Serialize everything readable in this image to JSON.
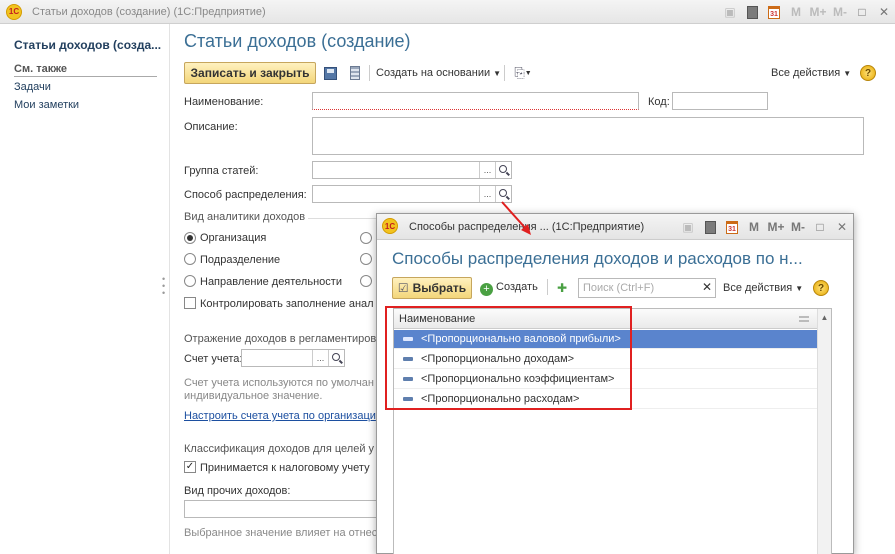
{
  "window": {
    "title": "Статьи доходов (создание)   (1С:Предприятие)",
    "logo_text": "1С",
    "buttons": [
      "M",
      "M+",
      "M-"
    ]
  },
  "sidebar": {
    "title": "Статьи доходов (созда...",
    "section": "См. также",
    "items": [
      "Задачи",
      "Мои заметки"
    ]
  },
  "form": {
    "title": "Статьи доходов (создание)",
    "toolbar": {
      "save_close": "Записать и закрыть",
      "create_based": "Создать на основании",
      "all_actions": "Все действия",
      "help": "?"
    },
    "fields": {
      "name_label": "Наименование:",
      "code_label": "Код:",
      "description_label": "Описание:",
      "group_label": "Группа статей:",
      "distribution_label": "Способ распределения:",
      "select_btn": "..."
    },
    "analytics": {
      "header": "Вид аналитики доходов",
      "options": [
        "Организация",
        "Подразделение",
        "Направление деятельности"
      ],
      "control_fill": "Контролировать заполнение анал"
    },
    "reflection": {
      "header": "Отражение доходов в регламентиров",
      "account_label": "Счет учета:",
      "note1": "Счет учета используются по умолчан",
      "note2": "индивидуальное значение.",
      "link": "Настроить счета учета по организаци"
    },
    "classification": {
      "header": "Классификация доходов для целей у",
      "tax_checkbox": "Принимается к налоговому учету",
      "other_income_label": "Вид прочих доходов:",
      "note": "Выбранное значение влияет на отнес"
    }
  },
  "dialog": {
    "title": "Способы распределения ...  (1С:Предприятие)",
    "logo_text": "1С",
    "heading": "Способы распределения доходов и расходов по н...",
    "toolbar": {
      "select": "Выбрать",
      "create": "Создать",
      "search_placeholder": "Поиск (Ctrl+F)",
      "all_actions": "Все действия",
      "help": "?"
    },
    "table": {
      "column": "Наименование",
      "rows": [
        "<Пропорционально валовой прибыли>",
        "<Пропорционально доходам>",
        "<Пропорционально коэффициентам>",
        "<Пропорционально расходам>"
      ],
      "selected_index": 0
    },
    "buttons": [
      "M",
      "M+",
      "M-"
    ]
  },
  "colors": {
    "accent_title": "#3b6f95",
    "selection": "#5a84cd",
    "highlight": "#e02020",
    "button_yellow": "#f3d67a"
  }
}
